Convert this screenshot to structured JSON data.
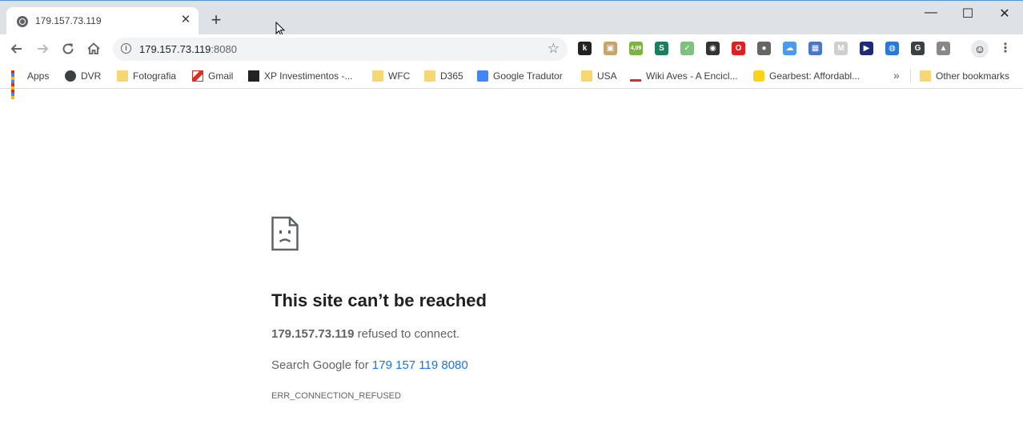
{
  "tab": {
    "title": "179.157.73.119",
    "close": "✕"
  },
  "newtab": "+",
  "window": {
    "minimize": "—",
    "maximize": "☐",
    "close": "✕"
  },
  "omnibox": {
    "host": "179.157.73.119",
    "port": ":8080"
  },
  "extensions": [
    {
      "icon": "k-icon",
      "label": "k",
      "color": "#222"
    },
    {
      "icon": "box-icon",
      "label": "▣",
      "color": "#c8a46a"
    },
    {
      "icon": "android-badge-icon",
      "label": "4,09",
      "color": "#7cb342"
    },
    {
      "icon": "s-icon",
      "label": "S",
      "color": "#1b7f5e"
    },
    {
      "icon": "tray-icon",
      "label": "✓",
      "color": "#7fbf7f"
    },
    {
      "icon": "camera-icon",
      "label": "◉",
      "color": "#333"
    },
    {
      "icon": "opera-icon",
      "label": "O",
      "color": "#e02020"
    },
    {
      "icon": "bulb-icon",
      "label": "●",
      "color": "#666"
    },
    {
      "icon": "cloud-icon",
      "label": "☁",
      "color": "#4a9be8"
    },
    {
      "icon": "calendar-icon",
      "label": "▦",
      "color": "#4a76c9"
    },
    {
      "icon": "m-icon",
      "label": "M",
      "color": "#cfcfcf"
    },
    {
      "icon": "play-icon",
      "label": "▶",
      "color": "#1e2a78"
    },
    {
      "icon": "globe-icon",
      "label": "◍",
      "color": "#2a7ad5"
    },
    {
      "icon": "g-icon",
      "label": "G",
      "color": "#3c4043"
    },
    {
      "icon": "drive-icon",
      "label": "▲",
      "color": "#888"
    }
  ],
  "bookmarks": [
    {
      "label": "Apps",
      "icon": "apps-grid-icon"
    },
    {
      "label": "DVR",
      "icon": "e-icon"
    },
    {
      "label": "Fotografia",
      "icon": "folder-icon"
    },
    {
      "label": "Gmail",
      "icon": "gmail-icon"
    },
    {
      "label": "XP Investimentos -...",
      "icon": "xp-icon"
    },
    {
      "label": "WFC",
      "icon": "folder-icon"
    },
    {
      "label": "D365",
      "icon": "folder-icon"
    },
    {
      "label": "Google Tradutor",
      "icon": "translate-icon"
    },
    {
      "label": "USA",
      "icon": "folder-icon"
    },
    {
      "label": "Wiki Aves - A Encicl...",
      "icon": "wiki-icon"
    },
    {
      "label": "Gearbest: Affordabl...",
      "icon": "gearbest-icon"
    }
  ],
  "more_bookmarks": "»",
  "other_bookmarks": "Other bookmarks",
  "error": {
    "heading": "This site can’t be reached",
    "host": "179.157.73.119",
    "refused": " refused to connect.",
    "search_prefix": "Search Google for ",
    "search_link": "179 157 119 8080",
    "code": "ERR_CONNECTION_REFUSED"
  }
}
